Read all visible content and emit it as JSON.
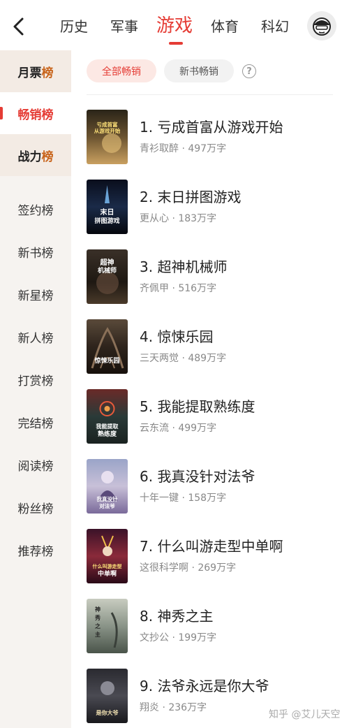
{
  "nav": {
    "tabs": [
      {
        "label": "历史"
      },
      {
        "label": "军事"
      },
      {
        "label": "游戏"
      },
      {
        "label": "体育"
      },
      {
        "label": "科幻"
      }
    ],
    "active_tab": "游戏"
  },
  "sidebar": {
    "items": [
      {
        "label_main": "月票",
        "label_suffix": "榜"
      },
      {
        "label_main": "畅销",
        "label_suffix": "榜"
      },
      {
        "label_main": "战力",
        "label_suffix": "榜"
      },
      {
        "label": "签约榜"
      },
      {
        "label": "新书榜"
      },
      {
        "label": "新星榜"
      },
      {
        "label": "新人榜"
      },
      {
        "label": "打赏榜"
      },
      {
        "label": "完结榜"
      },
      {
        "label": "阅读榜"
      },
      {
        "label": "粉丝榜"
      },
      {
        "label": "推荐榜"
      }
    ],
    "selected": "畅销榜"
  },
  "filters": {
    "all": "全部畅销",
    "new": "新书畅销",
    "help": "?"
  },
  "books": [
    {
      "title": "1. 亏成首富从游戏开始",
      "author": "青衫取醉",
      "words": "497万字",
      "cover_text": "亏成首富从游戏开始"
    },
    {
      "title": "2. 末日拼图游戏",
      "author": "更从心",
      "words": "183万字",
      "cover_text": "末日拼图游戏"
    },
    {
      "title": "3. 超神机械师",
      "author": "齐佩甲",
      "words": "516万字",
      "cover_text": "超神机械师"
    },
    {
      "title": "4. 惊悚乐园",
      "author": "三天两觉",
      "words": "489万字",
      "cover_text": "惊悚乐园"
    },
    {
      "title": "5. 我能提取熟练度",
      "author": "云东流",
      "words": "499万字",
      "cover_text": "我能提取熟练度"
    },
    {
      "title": "6. 我真没针对法爷",
      "author": "十年一键",
      "words": "158万字",
      "cover_text": "我真没针对法爷"
    },
    {
      "title": "7. 什么叫游走型中单啊",
      "author": "这很科学啊",
      "words": "269万字",
      "cover_text": "什么叫游走型中单啊"
    },
    {
      "title": "8. 神秀之主",
      "author": "文抄公",
      "words": "199万字",
      "cover_text": "神秀之主"
    },
    {
      "title": "9. 法爷永远是你大爷",
      "author": "翔炎",
      "words": "236万字",
      "cover_text": "是你大爷"
    }
  ],
  "meta_separator": " · ",
  "watermark": "知乎 @艾儿天空",
  "colors": {
    "accent": "#e53c35",
    "rank_highlight": "#c8641b",
    "sidebar_bg": "#f6f3f0"
  },
  "icons": [
    "back-chevron-icon",
    "user-avatar-icon",
    "help-circle-icon"
  ]
}
